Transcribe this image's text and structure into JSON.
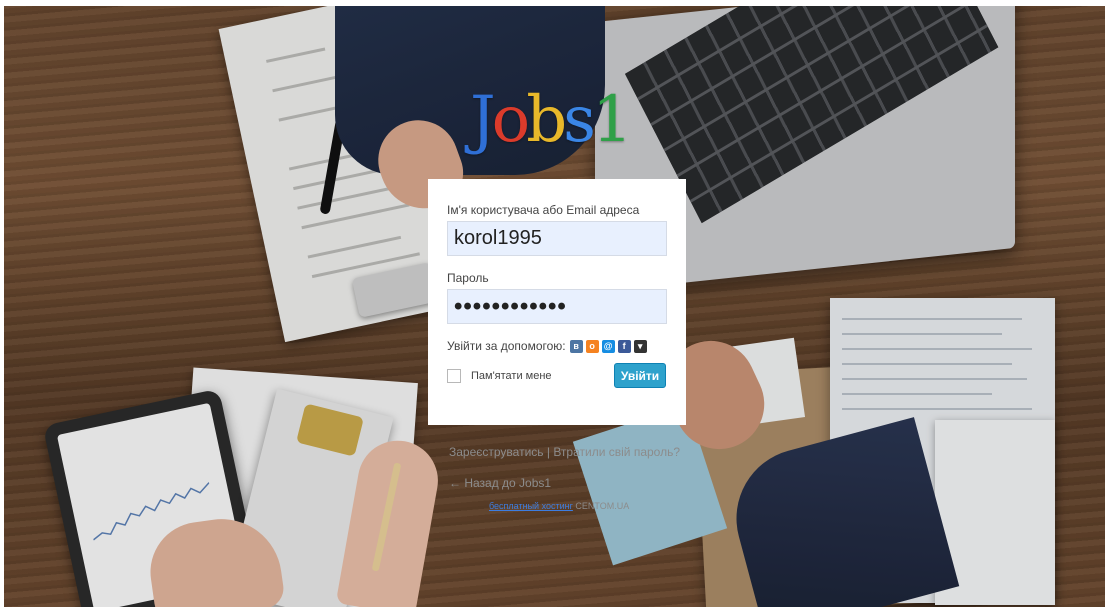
{
  "logo": {
    "letters": [
      "J",
      "o",
      "b",
      "s",
      "1",
      ""
    ],
    "colors": [
      "#2f6fd6",
      "#db3b2b",
      "#e8b82a",
      "#3a86e6",
      "#e8c630"
    ]
  },
  "login": {
    "username_label": "Ім'я користувача або Email адреса",
    "username_value": "korol1995",
    "password_label": "Пароль",
    "password_value": "••••••••••••",
    "social_label": "Увійти за допомогою:",
    "social_icons": [
      "vk-icon",
      "odnoklassniki-icon",
      "mailru-icon",
      "facebook-icon",
      "more-icon"
    ],
    "remember_label": "Пам'ятати мене",
    "submit_label": "Увійти"
  },
  "links": {
    "register": "Зареєструватись",
    "separator": " | ",
    "lost_password": "Втратили свій пароль?",
    "back_to_site": "← Назад до Jobs1",
    "hosting_link": "бесплатный хостинг",
    "hosting_domain": "CENTOM.UA"
  },
  "colors": {
    "submit_bg": "#2ea2cc",
    "input_bg": "#e8f0fe",
    "link": "#3d7de0"
  }
}
